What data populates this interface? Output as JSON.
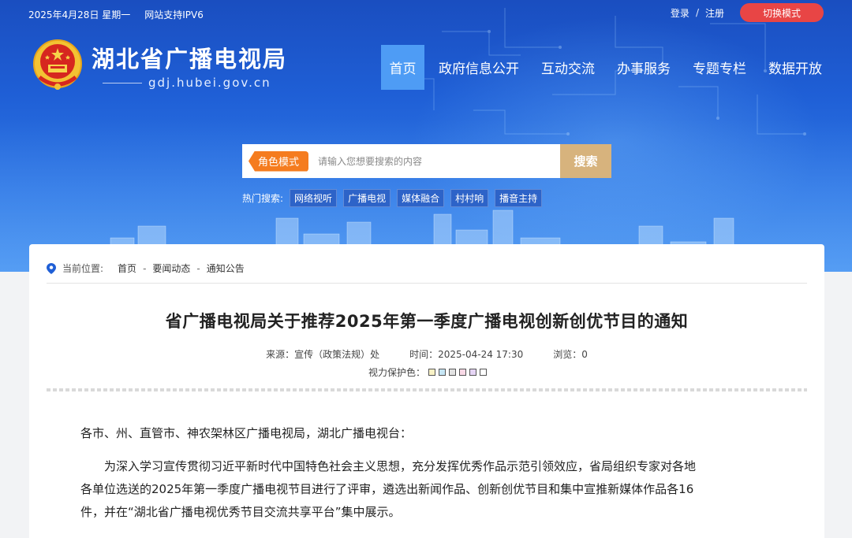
{
  "topbar": {
    "date": "2025年4月28日 星期一",
    "ipv6": "网站支持IPV6",
    "login": "登录",
    "separator": "/",
    "register": "注册",
    "mode_switch": "切换模式"
  },
  "site": {
    "title": "湖北省广播电视局",
    "domain": "gdj.hubei.gov.cn"
  },
  "nav": {
    "items": [
      "首页",
      "政府信息公开",
      "互动交流",
      "办事服务",
      "专题专栏",
      "数据开放"
    ]
  },
  "search": {
    "role_mode": "角色模式",
    "placeholder": "请输入您想要搜索的内容",
    "button": "搜索"
  },
  "hot": {
    "label": "热门搜索:",
    "tags": [
      "网络视听",
      "广播电视",
      "媒体融合",
      "村村响",
      "播音主持"
    ]
  },
  "breadcrumb": {
    "label": "当前位置:",
    "items": [
      "首页",
      "要闻动态",
      "通知公告"
    ],
    "dash": "-"
  },
  "article": {
    "title": "省广播电视局关于推荐2025年第一季度广播电视创新创优节目的通知",
    "source": "来源：宣传（政策法规）处",
    "time": "时间：2025-04-24 17:30",
    "views": "浏览：0",
    "eye_label": "视力保护色：",
    "eye_colors": [
      "#f9f2c6",
      "#c6e6f5",
      "#e2e2e2",
      "#f9d9e6",
      "#e6d5f5",
      "#ffffff"
    ],
    "salutation": "各市、州、直管市、神农架林区广播电视局，湖北广播电视台：",
    "paragraph": "为深入学习宣传贯彻习近平新时代中国特色社会主义思想，充分发挥优秀作品示范引领效应，省局组织专家对各地各单位选送的2025年第一季度广播电视节目进行了评审，遴选出新闻作品、创新创优节目和集中宣推新媒体作品各16件，并在“湖北省广播电视优秀节目交流共享平台”集中展示。"
  },
  "colors": {
    "header_blue": "#1f5fd6",
    "nav_active": "#4e9cf5",
    "mode_button": "#e84545",
    "role_tag": "#f57c1f",
    "search_button": "#d7b37d"
  }
}
